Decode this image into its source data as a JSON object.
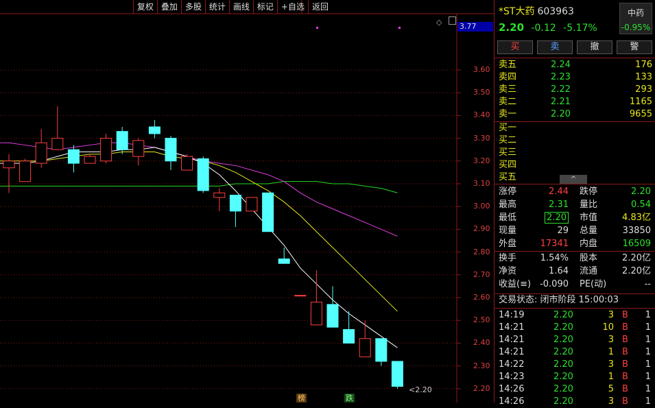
{
  "toolbar": [
    "复权",
    "叠加",
    "多股",
    "统计",
    "画线",
    "标记",
    "+自选",
    "返回"
  ],
  "chart": {
    "current_price_label": "3.77",
    "last_price_label": "2.20",
    "y_ticks": [
      "3.60",
      "3.50",
      "3.40",
      "3.30",
      "3.20",
      "3.10",
      "3.00",
      "2.90",
      "2.80",
      "2.70",
      "2.60",
      "2.50",
      "2.40",
      "2.30",
      "2.20"
    ],
    "bottom_tags": [
      "榜",
      "跌"
    ],
    "colors": {
      "up": "#ff4040",
      "down": "#54ffff",
      "ma5": "#ffffff",
      "ma10": "#e8e820",
      "ma20": "#e040e0",
      "ma60": "#22dd22",
      "grid": "#8b1a1a"
    }
  },
  "chart_data": {
    "type": "candlestick",
    "ylim": [
      2.2,
      3.6
    ],
    "candles": [
      {
        "o": 3.17,
        "c": 3.2,
        "h": 3.23,
        "l": 3.06
      },
      {
        "o": 3.11,
        "c": 3.2,
        "h": 3.21,
        "l": 3.11
      },
      {
        "o": 3.19,
        "c": 3.28,
        "h": 3.34,
        "l": 3.17
      },
      {
        "o": 3.25,
        "c": 3.3,
        "h": 3.44,
        "l": 3.25
      },
      {
        "o": 3.25,
        "c": 3.19,
        "h": 3.27,
        "l": 3.15
      },
      {
        "o": 3.19,
        "c": 3.22,
        "h": 3.23,
        "l": 3.19
      },
      {
        "o": 3.2,
        "c": 3.3,
        "h": 3.32,
        "l": 3.19
      },
      {
        "o": 3.33,
        "c": 3.25,
        "h": 3.35,
        "l": 3.23
      },
      {
        "o": 3.22,
        "c": 3.29,
        "h": 3.3,
        "l": 3.18
      },
      {
        "o": 3.35,
        "c": 3.32,
        "h": 3.38,
        "l": 3.3
      },
      {
        "o": 3.3,
        "c": 3.2,
        "h": 3.31,
        "l": 3.16
      },
      {
        "o": 3.16,
        "c": 3.22,
        "h": 3.23,
        "l": 3.16
      },
      {
        "o": 3.21,
        "c": 3.07,
        "h": 3.22,
        "l": 3.06
      },
      {
        "o": 3.04,
        "c": 3.06,
        "h": 3.08,
        "l": 2.98
      },
      {
        "o": 3.05,
        "c": 2.98,
        "h": 3.05,
        "l": 2.91
      },
      {
        "o": 2.98,
        "c": 3.04,
        "h": 3.04,
        "l": 2.98
      },
      {
        "o": 3.06,
        "c": 2.89,
        "h": 3.06,
        "l": 2.89
      },
      {
        "o": 2.77,
        "c": 2.75,
        "h": 2.82,
        "l": 2.75
      },
      {
        "o": 2.61,
        "c": 2.61,
        "h": 2.61,
        "l": 2.61
      },
      {
        "o": 2.48,
        "c": 2.58,
        "h": 2.72,
        "l": 2.48
      },
      {
        "o": 2.57,
        "c": 2.47,
        "h": 2.65,
        "l": 2.47
      },
      {
        "o": 2.46,
        "c": 2.4,
        "h": 2.54,
        "l": 2.4
      },
      {
        "o": 2.34,
        "c": 2.42,
        "h": 2.5,
        "l": 2.34
      },
      {
        "o": 2.42,
        "c": 2.32,
        "h": 2.42,
        "l": 2.3
      },
      {
        "o": 2.32,
        "c": 2.21,
        "h": 2.32,
        "l": 2.2
      }
    ],
    "ma5": [
      3.19,
      3.19,
      3.2,
      3.22,
      3.24,
      3.24,
      3.24,
      3.25,
      3.25,
      3.26,
      3.24,
      3.22,
      3.19,
      3.14,
      3.07,
      2.99,
      2.91,
      2.83,
      2.73,
      2.66,
      2.59,
      2.53,
      2.48,
      2.43,
      2.38
    ],
    "ma10": [
      3.2,
      3.2,
      3.2,
      3.21,
      3.22,
      3.23,
      3.23,
      3.24,
      3.24,
      3.24,
      3.22,
      3.21,
      3.2,
      3.18,
      3.15,
      3.11,
      3.07,
      3.02,
      2.96,
      2.89,
      2.82,
      2.75,
      2.68,
      2.61,
      2.54
    ],
    "ma20": [
      3.28,
      3.27,
      3.26,
      3.25,
      3.26,
      3.27,
      3.28,
      3.28,
      3.27,
      3.26,
      3.24,
      3.22,
      3.2,
      3.19,
      3.18,
      3.16,
      3.14,
      3.11,
      3.06,
      3.02,
      2.99,
      2.96,
      2.93,
      2.9,
      2.87
    ],
    "ma60": [
      3.09,
      3.09,
      3.09,
      3.09,
      3.09,
      3.09,
      3.09,
      3.09,
      3.09,
      3.09,
      3.09,
      3.09,
      3.09,
      3.09,
      3.1,
      3.1,
      3.1,
      3.11,
      3.11,
      3.11,
      3.1,
      3.1,
      3.09,
      3.08,
      3.06
    ]
  },
  "stock": {
    "name": "*ST大药",
    "code": "603963",
    "price": "2.20",
    "change": "-0.12",
    "pct": "-5.17%",
    "industry": "中药",
    "industry_pct": "-0.95%"
  },
  "buttons": [
    "买",
    "卖",
    "撤",
    "警"
  ],
  "sell_book": [
    {
      "label": "卖五",
      "price": "2.24",
      "vol": "176"
    },
    {
      "label": "卖四",
      "price": "2.23",
      "vol": "133"
    },
    {
      "label": "卖三",
      "price": "2.22",
      "vol": "293"
    },
    {
      "label": "卖二",
      "price": "2.21",
      "vol": "1165"
    },
    {
      "label": "卖一",
      "price": "2.20",
      "vol": "9655"
    }
  ],
  "buy_book": [
    "买一",
    "买二",
    "买三",
    "买四",
    "买五"
  ],
  "caret": "^",
  "stats": {
    "zhangting_l": "涨停",
    "zhangting": "2.44",
    "dieting_l": "跌停",
    "dieting": "2.20",
    "zuigao_l": "最高",
    "zuigao": "2.31",
    "liangbi_l": "量比",
    "liangbi": "0.54",
    "zuidi_l": "最低",
    "zuidi": "2.20",
    "shizhi_l": "市值",
    "shizhi": "4.83亿",
    "xianliang_l": "现量",
    "xianliang": "29",
    "zongliang_l": "总量",
    "zongliang": "33850",
    "waipan_l": "外盘",
    "waipan": "17341",
    "neipan_l": "内盘",
    "neipan": "16509"
  },
  "fund": {
    "huanshou_l": "换手",
    "huanshou": "1.54%",
    "guben_l": "股本",
    "guben": "2.20亿",
    "jingzi_l": "净资",
    "jingzi": "1.64",
    "liutong_l": "流通",
    "liutong": "2.20亿",
    "shouyi_l": "收益(≡)",
    "shouyi": "-0.090",
    "pe_l": "PE(动)",
    "pe": "--"
  },
  "status": "交易状态: 闭市阶段 15:00:03",
  "ticks": [
    {
      "t": "14:19",
      "p": "2.20",
      "v": "3",
      "s": "B",
      "n": "1"
    },
    {
      "t": "14:21",
      "p": "2.20",
      "v": "10",
      "s": "B",
      "n": "1"
    },
    {
      "t": "14:21",
      "p": "2.20",
      "v": "3",
      "s": "B",
      "n": "1"
    },
    {
      "t": "14:21",
      "p": "2.20",
      "v": "1",
      "s": "B",
      "n": "1"
    },
    {
      "t": "14:22",
      "p": "2.20",
      "v": "3",
      "s": "B",
      "n": "1"
    },
    {
      "t": "14:23",
      "p": "2.20",
      "v": "1",
      "s": "B",
      "n": "1"
    },
    {
      "t": "14:26",
      "p": "2.20",
      "v": "5",
      "s": "B",
      "n": "1"
    },
    {
      "t": "14:26",
      "p": "2.20",
      "v": "3",
      "s": "B",
      "n": "1"
    }
  ]
}
